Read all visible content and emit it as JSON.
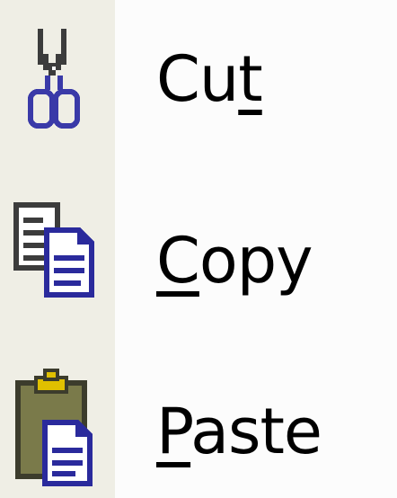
{
  "menu": {
    "items": [
      {
        "id": "cut",
        "label_pre": "Cu",
        "label_key": "t",
        "label_post": "",
        "icon": "scissors-icon"
      },
      {
        "id": "copy",
        "label_pre": "",
        "label_key": "C",
        "label_post": "opy",
        "icon": "copy-icon"
      },
      {
        "id": "paste",
        "label_pre": "",
        "label_key": "P",
        "label_post": "aste",
        "icon": "clipboard-icon"
      }
    ]
  },
  "colors": {
    "icon_strip": "#efeee5",
    "menu_background": "#fcfcfc",
    "scissor_handles": "#3a3aa8",
    "clipboard_board": "#7a7a4a",
    "clipboard_clip": "#e0c000",
    "document_blue": "#2a2a9c"
  }
}
